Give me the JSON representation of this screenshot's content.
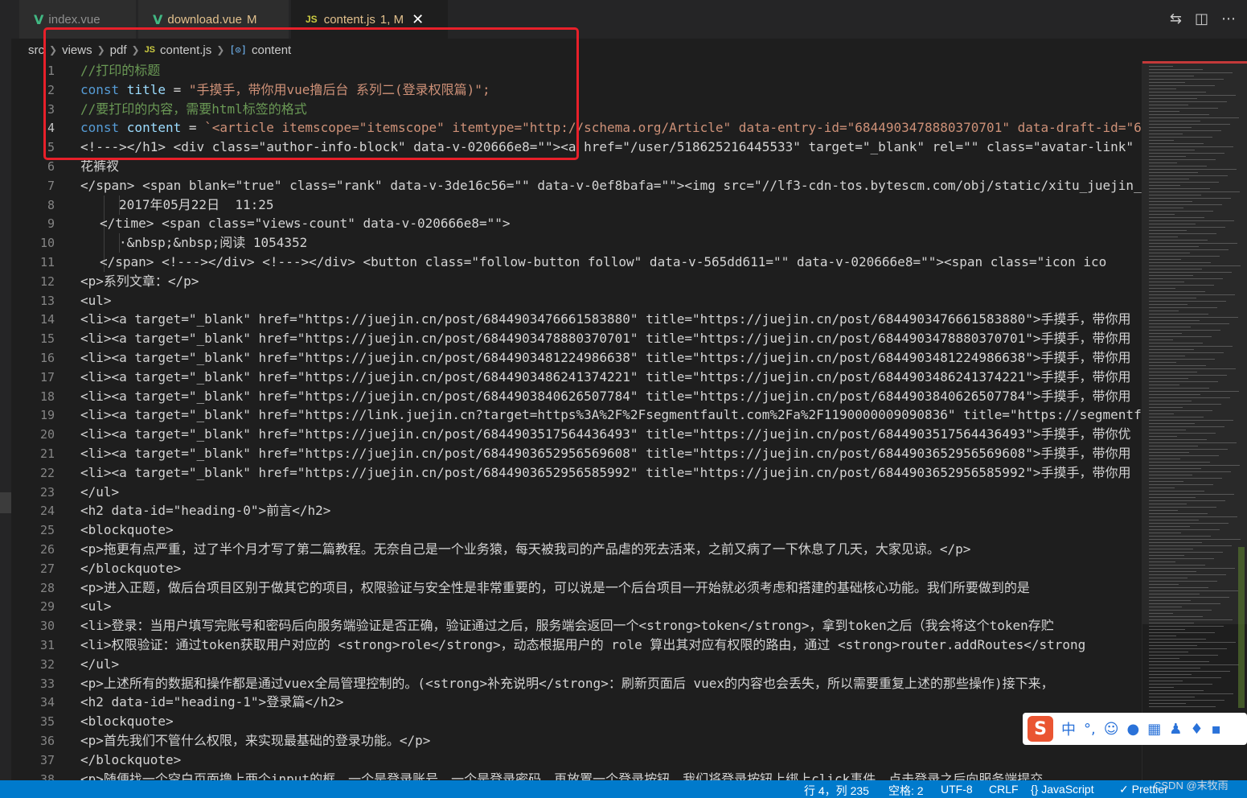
{
  "tabs": [
    {
      "icon": "V",
      "label": "index.vue",
      "modified": ""
    },
    {
      "icon": "V",
      "label": "download.vue",
      "modified": "M"
    },
    {
      "icon": "JS",
      "label": "content.js",
      "modified": "1, M",
      "close": "✕"
    }
  ],
  "tab_actions": [
    "compare-icon",
    "split-editor-icon",
    "more-icon"
  ],
  "breadcrumb": {
    "items": [
      "src",
      "views",
      "pdf",
      "content.js",
      "content"
    ],
    "js_icon": "JS",
    "symbol_icon": "[⊙]"
  },
  "editor": {
    "current_line": 4,
    "lines": [
      {
        "n": "1",
        "cls": "cmt",
        "text": "//打印的标题"
      },
      {
        "n": "2",
        "text": "const title = \"手摸手，带你用vue撸后台 系列二(登录权限篇)\";"
      },
      {
        "n": "3",
        "cls": "cmt",
        "text": "//要打印的内容，需要html标签的格式"
      },
      {
        "n": "4",
        "text": "const content = `<article itemscope=\"itemscope\" itemtype=\"http://schema.org/Article\" data-entry-id=\"6844903478880370701\" data-draft-id=\"6"
      },
      {
        "n": "5",
        "text": "<!---></h1> <div class=\"author-info-block\" data-v-020666e8=\"\"><a href=\"/user/518625216445533\" target=\"_blank\" rel=\"\" class=\"avatar-link\""
      },
      {
        "n": "6",
        "text": "花裤衩"
      },
      {
        "n": "7",
        "text": "</span> <span blank=\"true\" class=\"rank\" data-v-3de16c56=\"\" data-v-0ef8bafa=\"\"><img src=\"//lf3-cdn-tos.bytescm.com/obj/static/xitu_juejin_"
      },
      {
        "n": "8",
        "indent": 2,
        "text": "2017年05月22日  11:25"
      },
      {
        "n": "9",
        "indent": 1,
        "text": "</time> <span class=\"views-count\" data-v-020666e8=\"\">"
      },
      {
        "n": "10",
        "indent": 2,
        "text": "·&nbsp;&nbsp;阅读 1054352"
      },
      {
        "n": "11",
        "indent": 1,
        "text": "</span> <!---></div> <!---></div> <button class=\"follow-button follow\" data-v-565dd611=\"\" data-v-020666e8=\"\"><span class=\"icon ico"
      },
      {
        "n": "12",
        "text": "<p>系列文章：</p>"
      },
      {
        "n": "13",
        "text": "<ul>"
      },
      {
        "n": "14",
        "text": "<li><a target=\"_blank\" href=\"https://juejin.cn/post/6844903476661583880\" title=\"https://juejin.cn/post/6844903476661583880\">手摸手，带你用"
      },
      {
        "n": "15",
        "text": "<li><a target=\"_blank\" href=\"https://juejin.cn/post/6844903478880370701\" title=\"https://juejin.cn/post/6844903478880370701\">手摸手，带你用"
      },
      {
        "n": "16",
        "text": "<li><a target=\"_blank\" href=\"https://juejin.cn/post/6844903481224986638\" title=\"https://juejin.cn/post/6844903481224986638\">手摸手，带你用"
      },
      {
        "n": "17",
        "text": "<li><a target=\"_blank\" href=\"https://juejin.cn/post/6844903486241374221\" title=\"https://juejin.cn/post/6844903486241374221\">手摸手，带你用"
      },
      {
        "n": "18",
        "text": "<li><a target=\"_blank\" href=\"https://juejin.cn/post/6844903840626507784\" title=\"https://juejin.cn/post/6844903840626507784\">手摸手，带你用"
      },
      {
        "n": "19",
        "text": "<li><a target=\"_blank\" href=\"https://link.juejin.cn?target=https%3A%2F%2Fsegmentfault.com%2Fa%2F1190000009090836\" title=\"https://segmentf"
      },
      {
        "n": "20",
        "text": "<li><a target=\"_blank\" href=\"https://juejin.cn/post/6844903517564436493\" title=\"https://juejin.cn/post/6844903517564436493\">手摸手，带你优"
      },
      {
        "n": "21",
        "text": "<li><a target=\"_blank\" href=\"https://juejin.cn/post/6844903652956569608\" title=\"https://juejin.cn/post/6844903652956569608\">手摸手，带你用"
      },
      {
        "n": "22",
        "text": "<li><a target=\"_blank\" href=\"https://juejin.cn/post/6844903652956585992\" title=\"https://juejin.cn/post/6844903652956585992\">手摸手，带你用"
      },
      {
        "n": "23",
        "text": "</ul>"
      },
      {
        "n": "24",
        "text": "<h2 data-id=\"heading-0\">前言</h2>"
      },
      {
        "n": "25",
        "text": "<blockquote>"
      },
      {
        "n": "26",
        "text": "<p>拖更有点严重，过了半个月才写了第二篇教程。无奈自己是一个业务猿，每天被我司的产品虐的死去活来，之前又病了一下休息了几天，大家见谅。</p>"
      },
      {
        "n": "27",
        "text": "</blockquote>"
      },
      {
        "n": "28",
        "text": "<p>进入正题，做后台项目区别于做其它的项目，权限验证与安全性是非常重要的，可以说是一个后台项目一开始就必须考虑和搭建的基础核心功能。我们所要做到的是"
      },
      {
        "n": "29",
        "text": "<ul>"
      },
      {
        "n": "30",
        "text": "<li>登录：当用户填写完账号和密码后向服务端验证是否正确，验证通过之后，服务端会返回一个<strong>token</strong>，拿到token之后（我会将这个token存贮"
      },
      {
        "n": "31",
        "text": "<li>权限验证：通过token获取用户对应的 <strong>role</strong>，动态根据用户的 role 算出其对应有权限的路由，通过 <strong>router.addRoutes</strong"
      },
      {
        "n": "32",
        "text": "</ul>"
      },
      {
        "n": "33",
        "text": "<p>上述所有的数据和操作都是通过vuex全局管理控制的。(<strong>补充说明</strong>：刷新页面后 vuex的内容也会丢失，所以需要重复上述的那些操作)接下来，"
      },
      {
        "n": "34",
        "text": "<h2 data-id=\"heading-1\">登录篇</h2>"
      },
      {
        "n": "35",
        "text": "<blockquote>"
      },
      {
        "n": "36",
        "text": "<p>首先我们不管什么权限，来实现最基础的登录功能。</p>"
      },
      {
        "n": "37",
        "text": "</blockquote>"
      },
      {
        "n": "38",
        "text": "<p>随便找一个空白页面撸上两个input的框，一个是登录账号，一个是登录密码。再放置一个登录按钮，我们将登录按钮上绑上click事件，点击登录之后向服务端提交"
      }
    ]
  },
  "ime": {
    "logo": "S",
    "mode": "中",
    "punct": "°,",
    "icons": [
      "emoji-icon",
      "mic-icon",
      "keyboard-icon",
      "user-icon",
      "shirt-icon",
      "grid-icon"
    ]
  },
  "statusbar": {
    "position": "行 4，列 235",
    "spaces": "空格: 2",
    "encoding": "UTF-8",
    "eol": "CRLF",
    "language": "{} JavaScript",
    "formatter": "✓ Prettier"
  },
  "watermark": "CSDN @末牧雨",
  "colors": {
    "accent": "#007acc",
    "highlight_box": "#e8202a",
    "comment": "#6a9955",
    "keyword": "#569cd6",
    "string": "#ce9178"
  }
}
